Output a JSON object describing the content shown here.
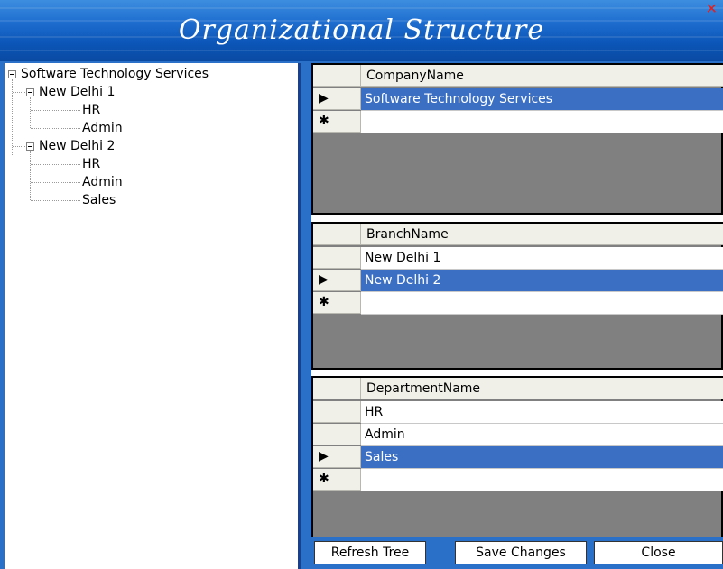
{
  "window": {
    "title": "Organizational Structure",
    "close_glyph": "✕"
  },
  "tree": {
    "root": "Software Technology Services",
    "branches": [
      {
        "label": "New Delhi 1",
        "children": [
          "HR",
          "Admin"
        ]
      },
      {
        "label": "New Delhi 2",
        "children": [
          "HR",
          "Admin",
          "Sales"
        ]
      }
    ]
  },
  "company_grid": {
    "header": "CompanyName",
    "rows": [
      {
        "value": "Software Technology Services",
        "selected": true
      }
    ],
    "new_row_glyph": "✱",
    "current_row_glyph": "▶"
  },
  "branch_grid": {
    "header": "BranchName",
    "rows": [
      {
        "value": "New Delhi 1",
        "selected": false
      },
      {
        "value": "New Delhi 2",
        "selected": true
      }
    ],
    "new_row_glyph": "✱",
    "current_row_glyph": "▶"
  },
  "department_grid": {
    "header": "DepartmentName",
    "rows": [
      {
        "value": "HR",
        "selected": false
      },
      {
        "value": "Admin",
        "selected": false
      },
      {
        "value": "Sales",
        "selected": true
      }
    ],
    "new_row_glyph": "✱",
    "current_row_glyph": "▶"
  },
  "buttons": {
    "refresh": "Refresh Tree",
    "save": "Save Changes",
    "close": "Close"
  },
  "colors": {
    "selection": "#3b6fc4",
    "title_bar": "#1f6fd0",
    "grid_background": "#808080"
  }
}
